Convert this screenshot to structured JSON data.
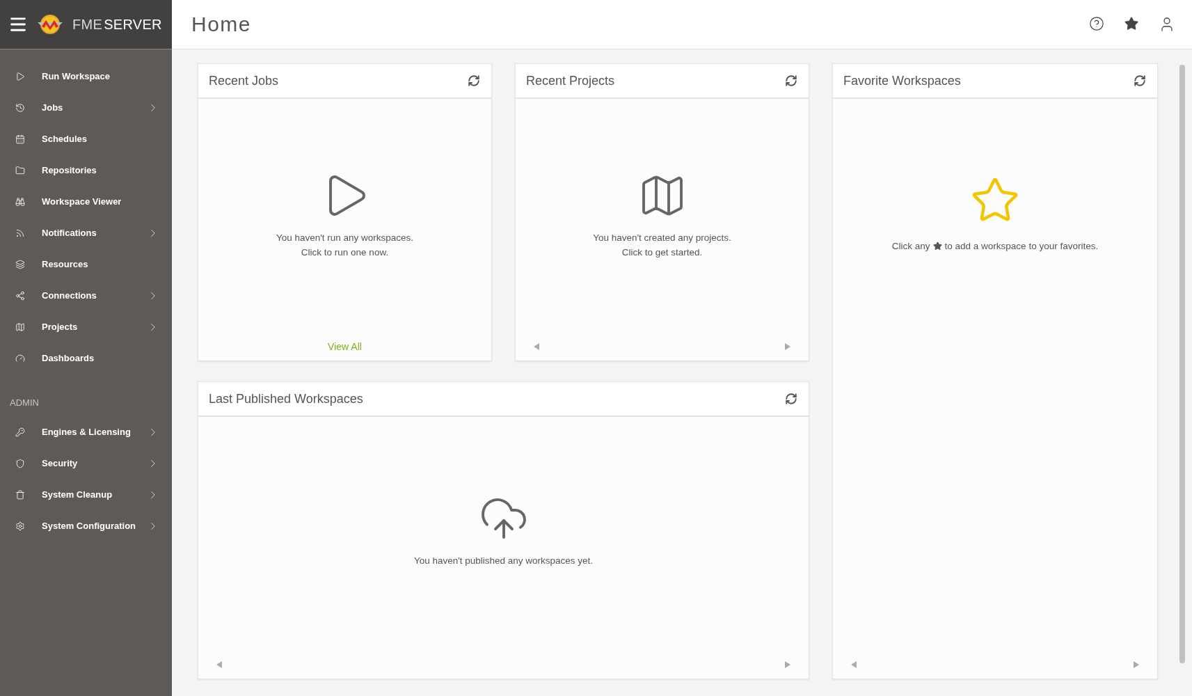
{
  "brand": {
    "part1": "FME",
    "part2": "SERVER"
  },
  "page_title": "Home",
  "sidebar": {
    "items": [
      {
        "label": "Run Workspace",
        "has_submenu": false
      },
      {
        "label": "Jobs",
        "has_submenu": true
      },
      {
        "label": "Schedules",
        "has_submenu": false
      },
      {
        "label": "Repositories",
        "has_submenu": false
      },
      {
        "label": "Workspace Viewer",
        "has_submenu": false
      },
      {
        "label": "Notifications",
        "has_submenu": true
      },
      {
        "label": "Resources",
        "has_submenu": false
      },
      {
        "label": "Connections",
        "has_submenu": true
      },
      {
        "label": "Projects",
        "has_submenu": true
      },
      {
        "label": "Dashboards",
        "has_submenu": false
      }
    ],
    "admin_heading": "ADMIN",
    "admin_items": [
      {
        "label": "Engines & Licensing",
        "has_submenu": true
      },
      {
        "label": "Security",
        "has_submenu": true
      },
      {
        "label": "System Cleanup",
        "has_submenu": true
      },
      {
        "label": "System Configuration",
        "has_submenu": true
      }
    ]
  },
  "cards": {
    "recent_jobs": {
      "title": "Recent Jobs",
      "message": [
        "You haven't run any workspaces.",
        "Click to run one now."
      ],
      "link": "View All"
    },
    "recent_projects": {
      "title": "Recent Projects",
      "message": [
        "You haven't created any projects.",
        "Click to get started."
      ]
    },
    "favorite_workspaces": {
      "title": "Favorite Workspaces",
      "hint_before": "Click any",
      "hint_after": "to add a workspace to your favorites."
    },
    "last_published": {
      "title": "Last Published Workspaces",
      "message": [
        "You haven't published any workspaces yet."
      ]
    }
  }
}
